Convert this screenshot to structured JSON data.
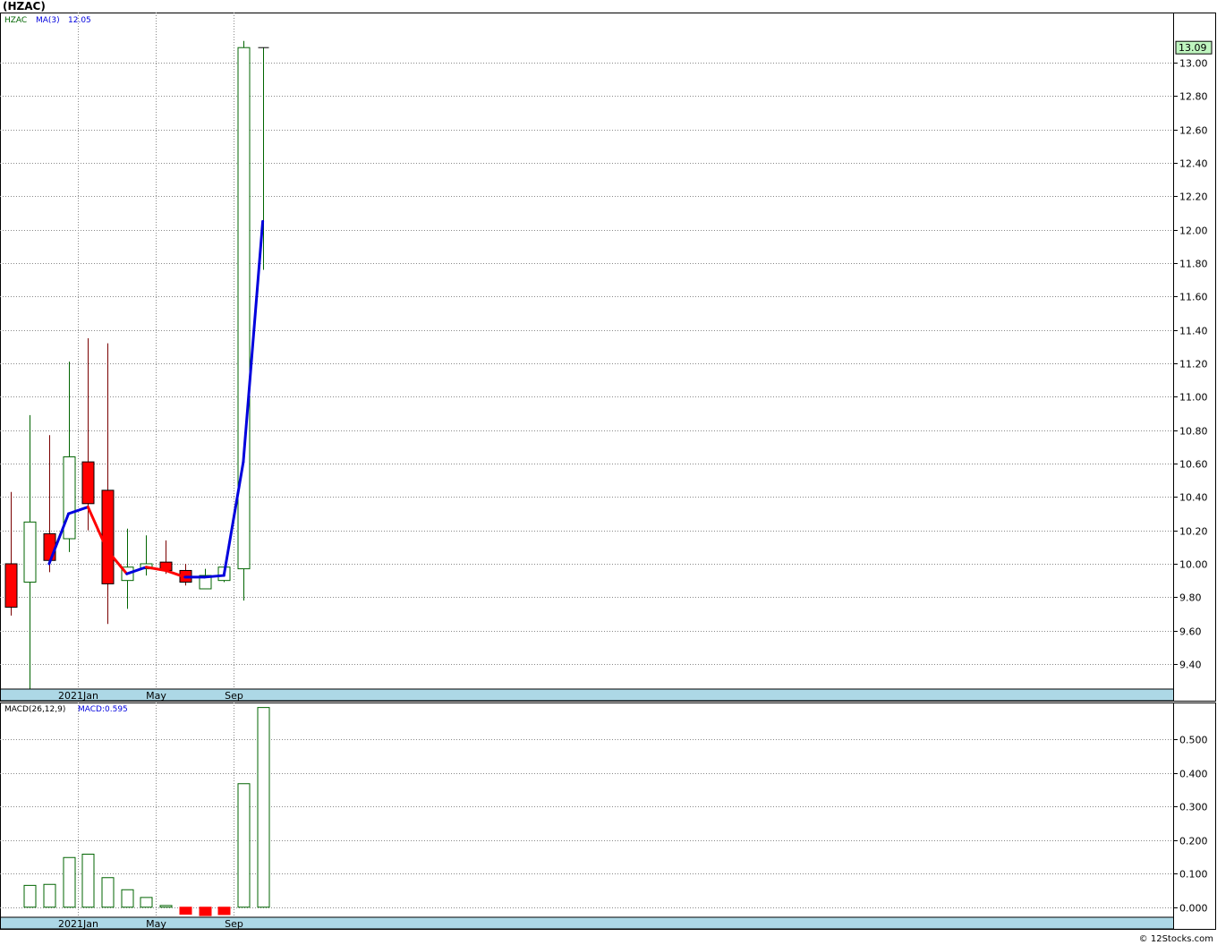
{
  "header": {
    "title": "(HZAC)",
    "copyright": "© 12Stocks.com"
  },
  "colors": {
    "up": "#006400",
    "down": "#ff0000",
    "wick": "#7a0000",
    "ma_up": "#0000dd",
    "ma_down": "#ff0000",
    "macd": "#006400",
    "axis_band": "#add8e6",
    "grid": "#888888",
    "last_box": "#bff5bf"
  },
  "chart_data": [
    {
      "type": "candlestick",
      "legend": {
        "symbol": "HZAC",
        "ma_label": "MA(3)",
        "ma_value": "12.05"
      },
      "last_value_label": "13.09",
      "ylim": [
        9.25,
        13.3
      ],
      "yticks": [
        "9.40",
        "9.60",
        "9.80",
        "10.00",
        "10.20",
        "10.40",
        "10.60",
        "10.80",
        "11.00",
        "11.20",
        "11.40",
        "11.60",
        "11.80",
        "12.00",
        "12.20",
        "12.40",
        "12.60",
        "12.80",
        "13.00"
      ],
      "xticks": [
        {
          "label": "2021Jan",
          "slot": 3.5
        },
        {
          "label": "May",
          "slot": 7.5
        },
        {
          "label": "Sep",
          "slot": 11.5
        }
      ],
      "candles": [
        {
          "open": 10.0,
          "high": 10.43,
          "low": 9.69,
          "close": 9.74
        },
        {
          "open": 9.89,
          "high": 10.89,
          "low": 9.25,
          "close": 10.25
        },
        {
          "open": 10.18,
          "high": 10.77,
          "low": 9.95,
          "close": 10.02
        },
        {
          "open": 10.15,
          "high": 11.21,
          "low": 10.07,
          "close": 10.64
        },
        {
          "open": 10.61,
          "high": 11.35,
          "low": 10.2,
          "close": 10.36
        },
        {
          "open": 10.44,
          "high": 11.32,
          "low": 9.64,
          "close": 9.88
        },
        {
          "open": 9.9,
          "high": 10.21,
          "low": 9.73,
          "close": 9.98
        },
        {
          "open": 9.97,
          "high": 10.17,
          "low": 9.93,
          "close": 10.0
        },
        {
          "open": 10.01,
          "high": 10.14,
          "low": 9.94,
          "close": 9.96
        },
        {
          "open": 9.96,
          "high": 10.0,
          "low": 9.87,
          "close": 9.89
        },
        {
          "open": 9.85,
          "high": 9.97,
          "low": 9.85,
          "close": 9.93
        },
        {
          "open": 9.9,
          "high": 9.98,
          "low": 9.89,
          "close": 9.98
        },
        {
          "open": 9.97,
          "high": 13.13,
          "low": 9.78,
          "close": 13.09
        },
        {
          "open": 13.09,
          "high": 13.09,
          "low": 11.76,
          "close": 13.09
        }
      ],
      "ma": [
        null,
        null,
        10.0,
        10.3,
        10.34,
        10.08,
        9.94,
        9.98,
        9.96,
        9.92,
        9.92,
        9.93,
        10.61,
        12.05
      ]
    },
    {
      "type": "bar",
      "legend": {
        "name": "MACD(26,12,9)",
        "value_label": "MACD:0.595"
      },
      "ylim": [
        -0.03,
        0.61
      ],
      "yticks": [
        "0.000",
        "0.100",
        "0.200",
        "0.300",
        "0.400",
        "0.500"
      ],
      "xticks": [
        {
          "label": "2021Jan",
          "slot": 3.5
        },
        {
          "label": "May",
          "slot": 7.5
        },
        {
          "label": "Sep",
          "slot": 11.5
        }
      ],
      "values": [
        null,
        0.065,
        0.068,
        0.148,
        0.158,
        0.088,
        0.052,
        0.029,
        0.005,
        -0.021,
        -0.025,
        -0.022,
        0.368,
        0.595
      ]
    }
  ]
}
